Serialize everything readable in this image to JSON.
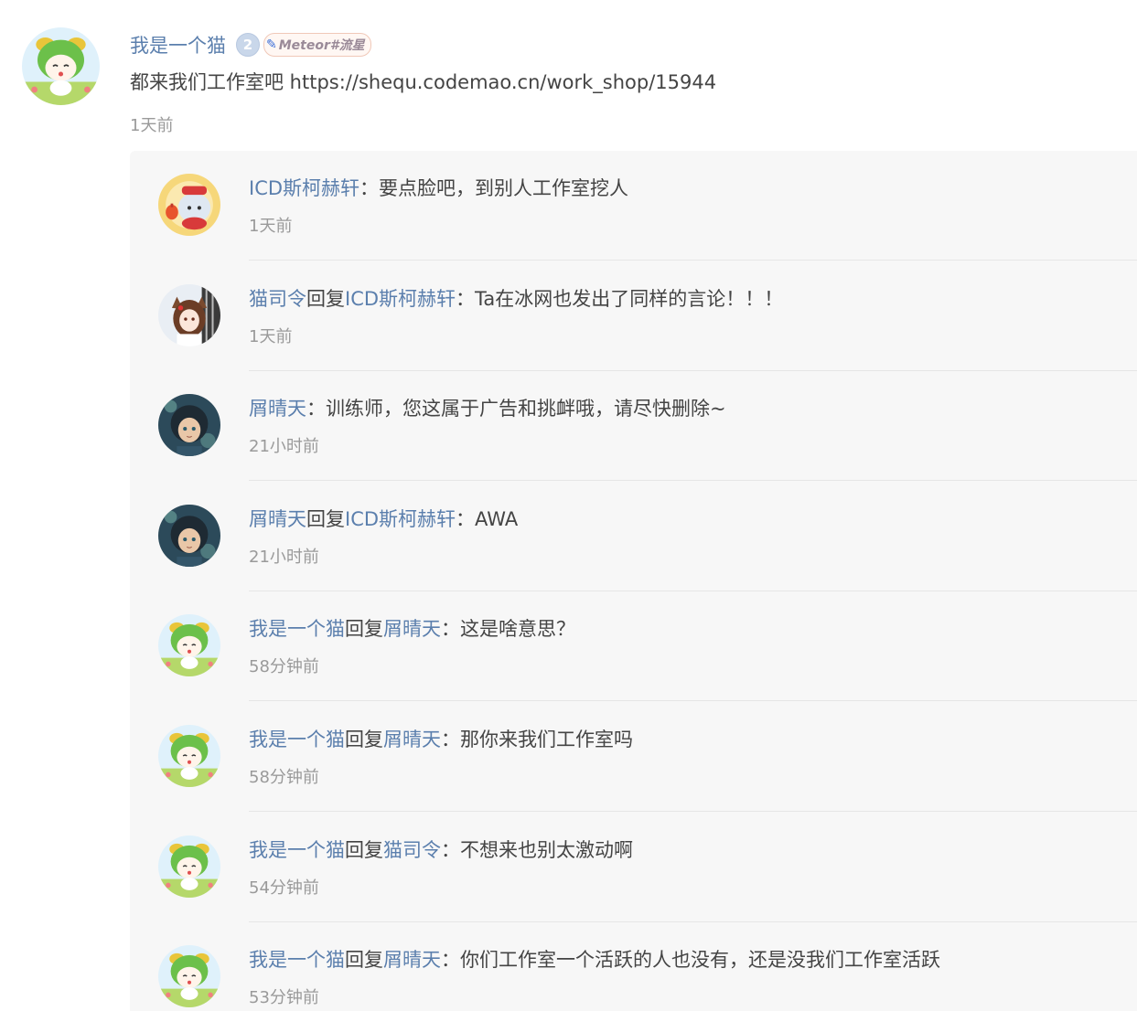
{
  "post": {
    "author": "我是一个猫",
    "level": "2",
    "title_badge": "Meteor#流星",
    "content": "都来我们工作室吧 https://shequ.codemao.cn/work_shop/15944",
    "time": "1天前"
  },
  "replies": [
    {
      "user": "ICD斯柯赫轩",
      "reply_word": "",
      "reply_to": "",
      "sep": "：",
      "text": "要点脸吧，到别人工作室挖人",
      "time": "1天前",
      "avatar": "bear-lantern-avatar"
    },
    {
      "user": "猫司令",
      "reply_word": "回复",
      "reply_to": "ICD斯柯赫轩",
      "sep": "：",
      "text": "Ta在冰网也发出了同样的言论！！！",
      "time": "1天前",
      "avatar": "fox-girl-avatar"
    },
    {
      "user": "屑晴天",
      "reply_word": "",
      "reply_to": "",
      "sep": "：",
      "text": "训练师，您这属于广告和挑衅哦，请尽快删除~",
      "time": "21小时前",
      "avatar": "anime-boy-avatar"
    },
    {
      "user": "屑晴天",
      "reply_word": "回复",
      "reply_to": "ICD斯柯赫轩",
      "sep": "：",
      "text": "AWA",
      "time": "21小时前",
      "avatar": "anime-boy-avatar"
    },
    {
      "user": "我是一个猫",
      "reply_word": "回复",
      "reply_to": "屑晴天",
      "sep": "：",
      "text": "这是啥意思？",
      "time": "58分钟前",
      "avatar": "green-sprout-avatar"
    },
    {
      "user": "我是一个猫",
      "reply_word": "回复",
      "reply_to": "屑晴天",
      "sep": "：",
      "text": "那你来我们工作室吗",
      "time": "58分钟前",
      "avatar": "green-sprout-avatar"
    },
    {
      "user": "我是一个猫",
      "reply_word": "回复",
      "reply_to": "猫司令",
      "sep": "：",
      "text": "不想来也别太激动啊",
      "time": "54分钟前",
      "avatar": "green-sprout-avatar"
    },
    {
      "user": "我是一个猫",
      "reply_word": "回复",
      "reply_to": "屑晴天",
      "sep": "：",
      "text": "你们工作室一个活跃的人也没有，还是没我们工作室活跃",
      "time": "53分钟前",
      "avatar": "green-sprout-avatar"
    }
  ]
}
